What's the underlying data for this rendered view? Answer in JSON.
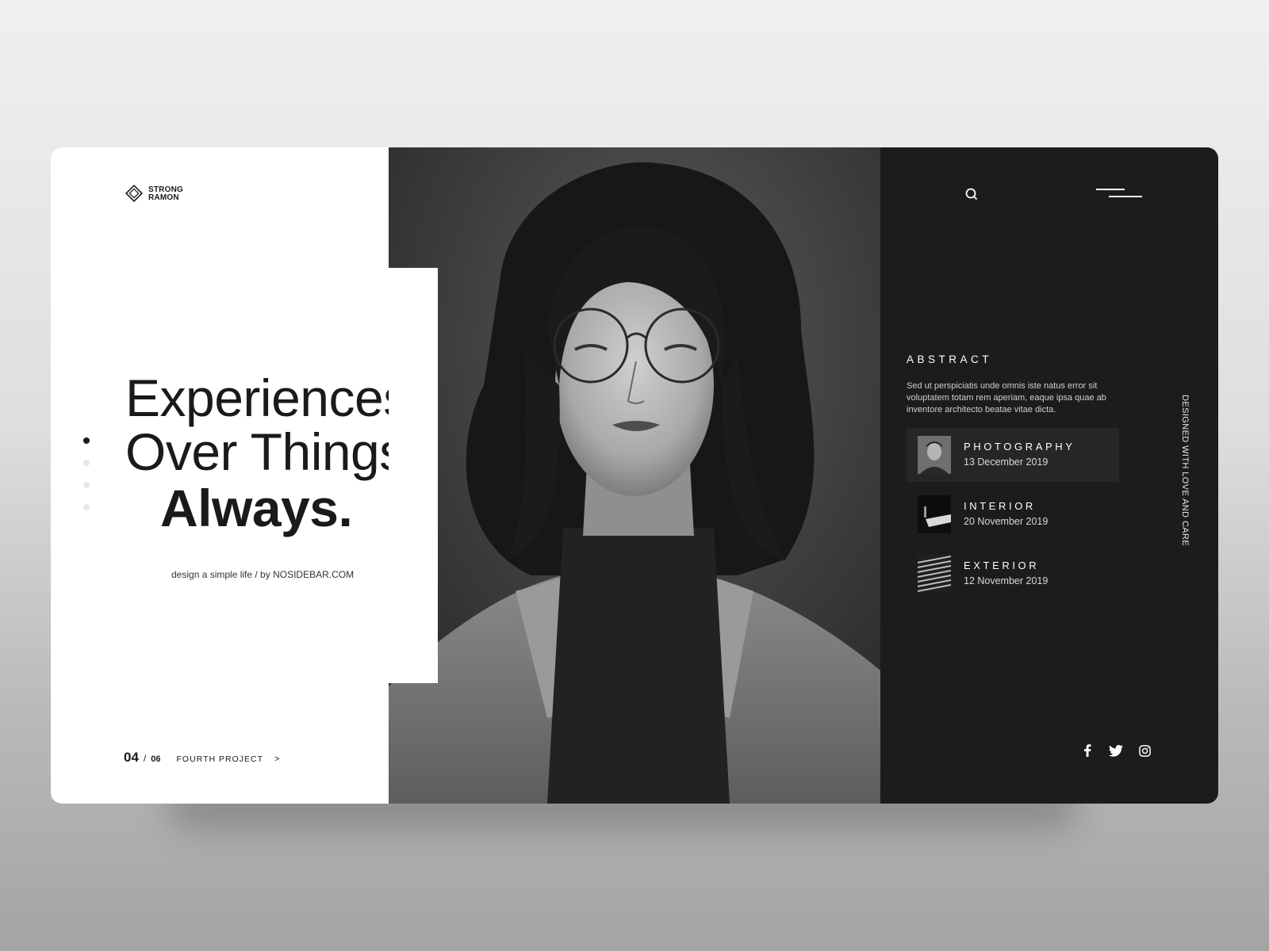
{
  "brand": {
    "line1": "STRONG",
    "line2": "RAMON"
  },
  "hero": {
    "line1": "Experiences",
    "line2": "Over Things",
    "line3": "Always.",
    "subline": "design a simple life / by NOSIDEBAR.COM"
  },
  "pager": {
    "current": "04",
    "separator": "/",
    "total": "06",
    "project": "FOURTH PROJECT",
    "arrow": ">"
  },
  "sidebar": {
    "abstract_title": "ABSTRACT",
    "abstract_text": "Sed ut perspiciatis unde omnis iste natus error sit voluptatem totam rem aperiam, eaque ipsa quae ab inventore architecto beatae vitae dicta.",
    "categories": [
      {
        "name": "PHOTOGRAPHY",
        "date": "13 December 2019"
      },
      {
        "name": "INTERIOR",
        "date": "20 November 2019"
      },
      {
        "name": "EXTERIOR",
        "date": "12 November 2019"
      }
    ],
    "vertical_tag": "DESIGNED WITH LOVE AND CARE"
  },
  "icons": {
    "search": "search-icon",
    "menu": "hamburger-menu-icon",
    "facebook": "facebook-icon",
    "twitter": "twitter-icon",
    "instagram": "instagram-icon"
  },
  "colors": {
    "dark_panel": "#1c1c1c",
    "active_item": "#262626",
    "text_dark": "#1a1a1a"
  }
}
